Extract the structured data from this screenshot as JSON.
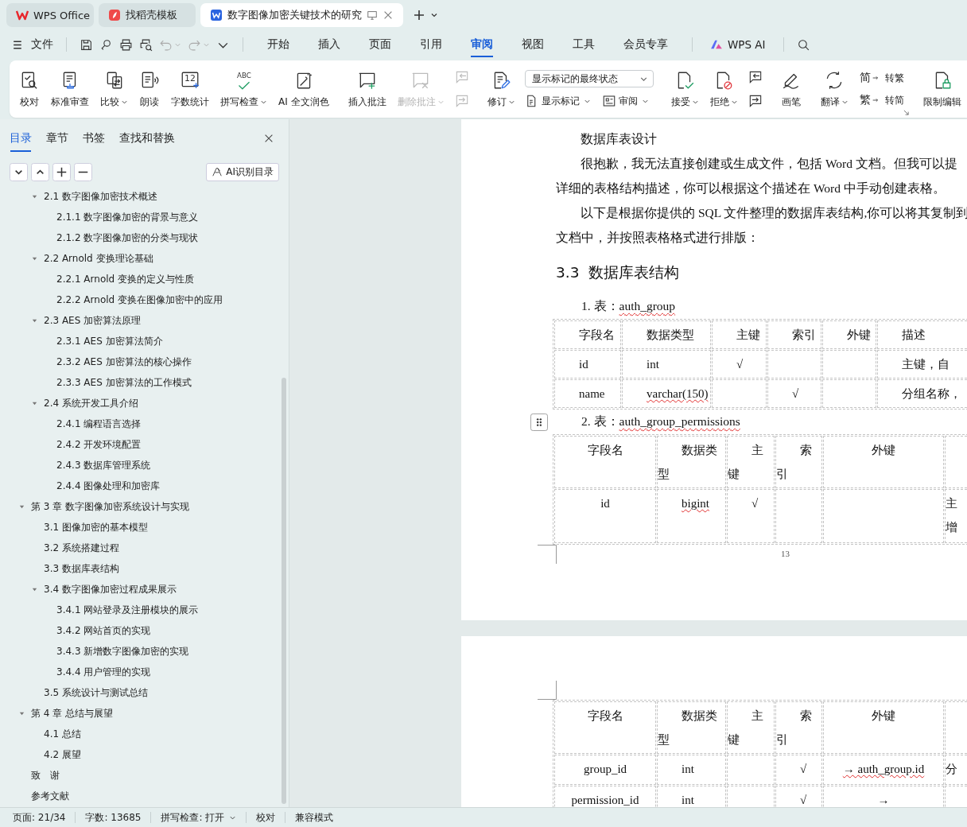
{
  "tabs": [
    {
      "title": "WPS Office",
      "kind": "home",
      "selected": false
    },
    {
      "title": "找稻壳模板",
      "kind": "templates",
      "selected": false
    },
    {
      "title": "数字图像加密关键技术的研究",
      "kind": "document",
      "selected": true
    }
  ],
  "menu_bar": {
    "file": "文件",
    "tabs": [
      {
        "label": "开始",
        "selected": false
      },
      {
        "label": "插入",
        "selected": false
      },
      {
        "label": "页面",
        "selected": false
      },
      {
        "label": "引用",
        "selected": false
      },
      {
        "label": "审阅",
        "selected": true
      },
      {
        "label": "视图",
        "selected": false
      },
      {
        "label": "工具",
        "selected": false
      },
      {
        "label": "会员专享",
        "selected": false
      }
    ],
    "ai": "WPS AI"
  },
  "ribbon": {
    "proofing": [
      {
        "label": "校对",
        "dropdown": false
      },
      {
        "label": "标准审查",
        "dropdown": false
      },
      {
        "label": "比较",
        "dropdown": true
      },
      {
        "label": "朗读",
        "dropdown": false
      },
      {
        "label": "字数统计",
        "dropdown": false,
        "glyph": "12"
      },
      {
        "label": "拼写检查",
        "dropdown": true,
        "glyph": "ABC"
      },
      {
        "label": "AI 全文润色",
        "dropdown": false
      }
    ],
    "comments": [
      {
        "label": "插入批注",
        "dropdown": false,
        "disabled": false
      },
      {
        "label": "删除批注",
        "dropdown": true,
        "disabled": true
      }
    ],
    "tracking": {
      "label": "修订",
      "markup_mode": "显示标记的最终状态",
      "show_markup": "显示标记",
      "review": "审阅"
    },
    "changes": [
      {
        "label": "接受",
        "dropdown": true
      },
      {
        "label": "拒绝",
        "dropdown": true
      }
    ],
    "pen": "画笔",
    "translate": "翻译",
    "convert": [
      {
        "glyph": "简",
        "label": "转繁"
      },
      {
        "glyph": "繁",
        "label": "转简"
      }
    ],
    "restrict": "限制编辑"
  },
  "sidebar": {
    "tabs": [
      {
        "label": "目录",
        "selected": true
      },
      {
        "label": "章节",
        "selected": false
      },
      {
        "label": "书签",
        "selected": false
      },
      {
        "label": "查找和替换",
        "selected": false
      }
    ],
    "ai_button": "AI识别目录",
    "toc": {
      "continued_children": [
        {
          "label": "2.1  数字图像加密技术概述",
          "expanded": true,
          "children": [
            {
              "label": "2.1.1  数字图像加密的背景与意义"
            },
            {
              "label": "2.1.2  数字图像加密的分类与现状"
            }
          ]
        },
        {
          "label": "2.2 Arnold 变换理论基础",
          "expanded": true,
          "children": [
            {
              "label": "2.2.1 Arnold 变换的定义与性质"
            },
            {
              "label": "2.2.2 Arnold 变换在图像加密中的应用"
            }
          ]
        },
        {
          "label": "2.3 AES 加密算法原理",
          "expanded": true,
          "children": [
            {
              "label": "2.3.1 AES 加密算法简介"
            },
            {
              "label": "2.3.2 AES 加密算法的核心操作"
            },
            {
              "label": "2.3.3 AES 加密算法的工作模式"
            }
          ]
        },
        {
          "label": "2.4  系统开发工具介绍",
          "expanded": true,
          "children": [
            {
              "label": "2.4.1  编程语言选择"
            },
            {
              "label": "2.4.2  开发环境配置"
            },
            {
              "label": "2.4.3  数据库管理系统"
            },
            {
              "label": "2.4.4  图像处理和加密库"
            }
          ]
        }
      ],
      "items": [
        {
          "label": "第 3 章  数字图像加密系统设计与实现",
          "expanded": true,
          "children": [
            {
              "label": "3.1  图像加密的基本模型"
            },
            {
              "label": "3.2  系统搭建过程"
            },
            {
              "label": "3.3  数据库表结构"
            },
            {
              "label": "3.4  数字图像加密过程成果展示",
              "expanded": true,
              "children": [
                {
                  "label": "3.4.1 网站登录及注册模块的展示"
                },
                {
                  "label": "3.4.2 网站首页的实现"
                },
                {
                  "label": "3.4.3 新增数字图像加密的实现"
                },
                {
                  "label": "3.4.4 用户管理的实现"
                }
              ]
            },
            {
              "label": "3.5 系统设计与测试总结"
            }
          ]
        },
        {
          "label": "第 4 章  总结与展望",
          "expanded": true,
          "children": [
            {
              "label": "4.1  总结"
            },
            {
              "label": "4.2  展望"
            }
          ]
        },
        {
          "label": "致　谢"
        },
        {
          "label": "参考文献"
        }
      ]
    }
  },
  "document": {
    "pages": [
      {
        "page_number": "13",
        "blocks": [
          {
            "kind": "line",
            "indent": true,
            "text": "数据库表设计"
          },
          {
            "kind": "line",
            "indent": true,
            "text": "很抱歉，我无法直接创建或生成文件，包括 Word 文档。但我可以提"
          },
          {
            "kind": "line",
            "indent": false,
            "text": "详细的表格结构描述，你可以根据这个描述在 Word 中手动创建表格。"
          },
          {
            "kind": "line",
            "indent": true,
            "text": "以下是根据你提供的 SQL 文件整理的数据库表结构,你可以将其复制到"
          },
          {
            "kind": "line",
            "indent": false,
            "text": "文档中，并按照表格格式进行排版："
          },
          {
            "kind": "heading",
            "number": "3.3",
            "text": "数据库表结构"
          },
          {
            "kind": "caption",
            "handle": false,
            "number": "1.",
            "label": "表：",
            "name": "auth_group",
            "misspelled": true
          },
          {
            "kind": "table",
            "header": [
              "字段名",
              "数据类型",
              "主键",
              "索引",
              "外键",
              "描述"
            ],
            "rows": [
              {
                "cells": [
                  {
                    "text": "id",
                    "misspelled": false
                  },
                  {
                    "text": "int",
                    "misspelled": false
                  },
                  {
                    "text": "√",
                    "misspelled": false
                  },
                  null,
                  null,
                  {
                    "text": "主键，自",
                    "misspelled": false
                  }
                ]
              },
              {
                "cells": [
                  {
                    "text": "name",
                    "misspelled": false
                  },
                  {
                    "text": "varchar(150)",
                    "misspelled": true
                  },
                  null,
                  {
                    "text": "√",
                    "misspelled": false
                  },
                  null,
                  {
                    "text": "分组名称，",
                    "misspelled": false
                  }
                ]
              }
            ]
          },
          {
            "kind": "caption",
            "handle": true,
            "number": "2.",
            "label": "表：",
            "name": "auth_group_permissions",
            "misspelled": true
          },
          {
            "kind": "table",
            "header": [
              "字段名",
              "数据类型",
              "主键",
              "索引",
              "外键"
            ],
            "rows": [
              {
                "cells": [
                  {
                    "text": "id",
                    "misspelled": false
                  },
                  {
                    "text": "bigint",
                    "misspelled": true
                  },
                  {
                    "text": "√",
                    "misspelled": false
                  },
                  null,
                  null,
                  {
                    "text": "主增",
                    "misspelled": false
                  }
                ]
              }
            ]
          }
        ]
      },
      {
        "blocks": [
          {
            "kind": "table",
            "header": [
              "字段名",
              "数据类型",
              "主键",
              "索引",
              "外键"
            ],
            "rows": [
              {
                "cells": [
                  {
                    "text": "group_id",
                    "misspelled": false
                  },
                  {
                    "text": "int",
                    "misspelled": false
                  },
                  null,
                  {
                    "text": "√",
                    "misspelled": false
                  },
                  {
                    "text": "→ auth_group.id",
                    "misspelled": true
                  },
                  {
                    "text": "分",
                    "misspelled": false
                  }
                ]
              },
              {
                "cells": [
                  {
                    "text": "permission_id",
                    "misspelled": false
                  },
                  {
                    "text": "int",
                    "misspelled": false
                  },
                  null,
                  {
                    "text": "√",
                    "misspelled": false
                  },
                  {
                    "text": "→",
                    "misspelled": false
                  },
                  null
                ]
              }
            ]
          }
        ]
      }
    ]
  },
  "status_bar": {
    "page": "页面: 21/34",
    "words": "字数: 13685",
    "spell_check": "拼写检查: 打开",
    "proofread": "校对",
    "mode": "兼容模式"
  }
}
